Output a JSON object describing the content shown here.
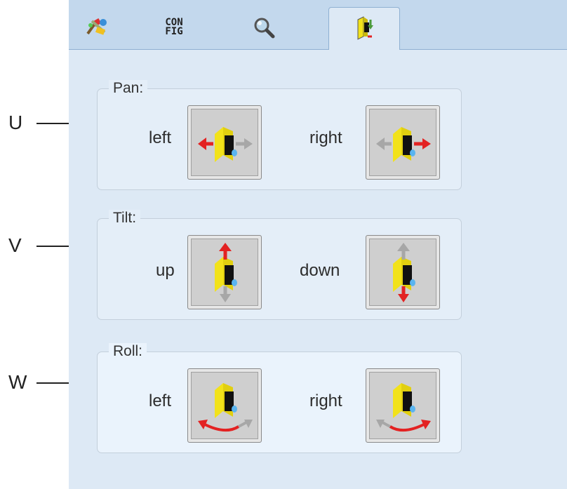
{
  "callouts": [
    "U",
    "V",
    "W"
  ],
  "tabs": [
    {
      "name": "tools",
      "icon": "colorful-tools-icon"
    },
    {
      "name": "config",
      "label_top": "CON",
      "label_bottom": "FIG"
    },
    {
      "name": "search",
      "icon": "magnifier-icon"
    },
    {
      "name": "camera-motion",
      "icon": "camera-arrows-icon",
      "active": true
    }
  ],
  "groups": {
    "pan": {
      "title": "Pan:",
      "left_label": "left",
      "right_label": "right"
    },
    "tilt": {
      "title": "Tilt:",
      "left_label": "up",
      "right_label": "down"
    },
    "roll": {
      "title": "Roll:",
      "left_label": "left",
      "right_label": "right"
    }
  },
  "colors": {
    "arrow_active": "#e32222",
    "arrow_inactive": "#a7a7a7",
    "camera_yellow": "#f2e21a",
    "panel_bg": "#dde9f5"
  }
}
